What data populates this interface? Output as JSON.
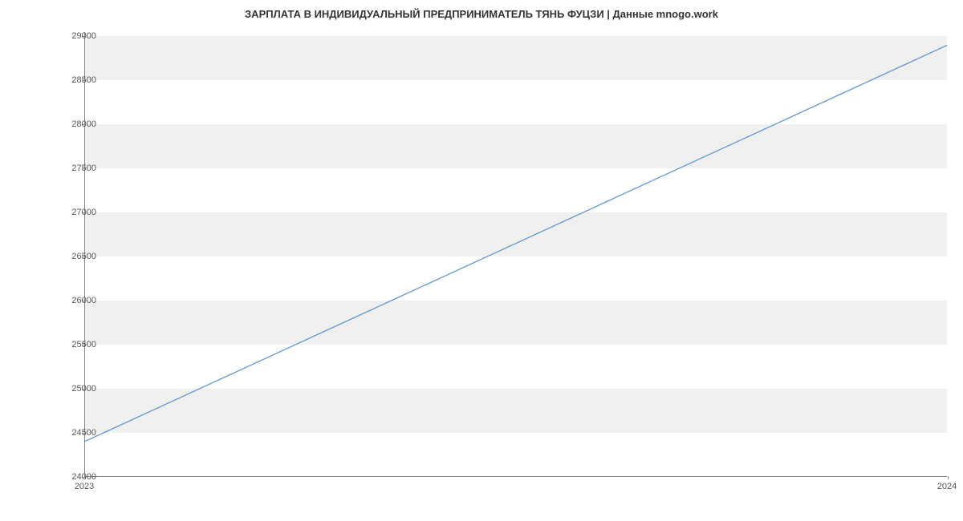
{
  "chart_data": {
    "type": "line",
    "title": "ЗАРПЛАТА В ИНДИВИДУАЛЬНЫЙ ПРЕДПРИНИМАТЕЛЬ ТЯНЬ ФУЦЗИ | Данные mnogo.work",
    "xlabel": "",
    "ylabel": "",
    "x": [
      2023,
      2024
    ],
    "values": [
      24400,
      28900
    ],
    "y_ticks": [
      24000,
      24500,
      25000,
      25500,
      26000,
      26500,
      27000,
      27500,
      28000,
      28500,
      29000
    ],
    "x_ticks": [
      2023,
      2024
    ],
    "ylim": [
      24000,
      29050
    ],
    "xlim": [
      2023,
      2024
    ],
    "line_color": "#6b9bd1"
  }
}
